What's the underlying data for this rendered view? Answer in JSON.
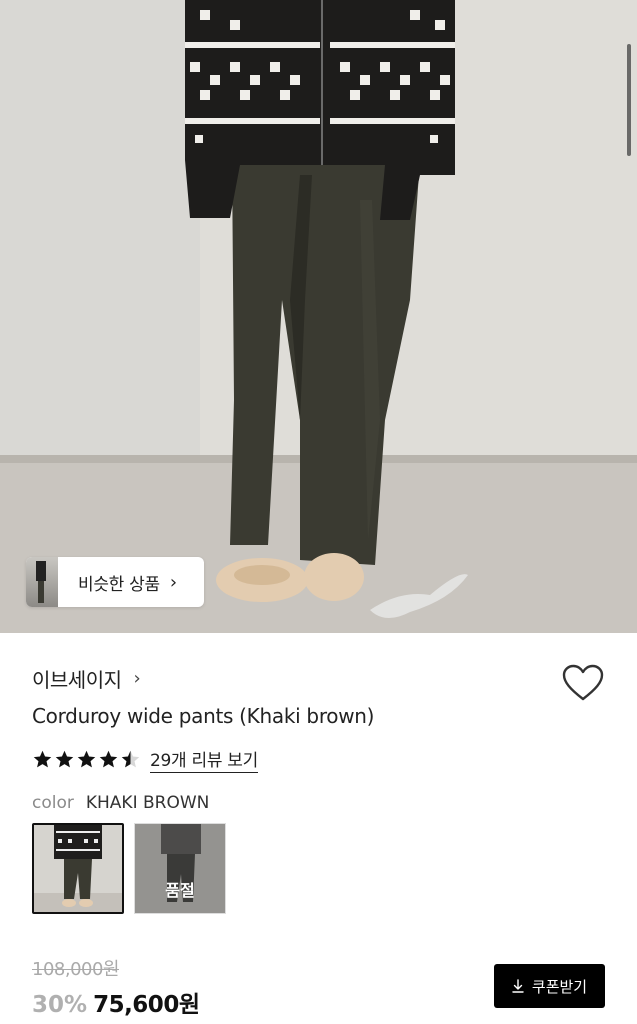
{
  "hero": {
    "similar_label": "비슷한 상품"
  },
  "product": {
    "brand": "이브세이지",
    "title": "Corduroy wide pants (Khaki brown)",
    "rating": 4.5,
    "review_link": "29개 리뷰 보기",
    "color_key": "color",
    "color_value": "KHAKI BROWN",
    "soldout_label": "품절",
    "original_price": "108,000원",
    "discount": "30%",
    "sale_price": "75,600원",
    "coupon_label": "쿠폰받기"
  },
  "icons": {
    "brand_chevron": "chevron-right-icon",
    "similar_chevron": "chevron-right-icon",
    "favorite": "heart-outline-icon",
    "coupon": "download-icon",
    "star": "star-icon"
  },
  "colors": {
    "accent": "#000000",
    "muted_price": "#aaaaaa",
    "discount": "#b0b0b0"
  }
}
